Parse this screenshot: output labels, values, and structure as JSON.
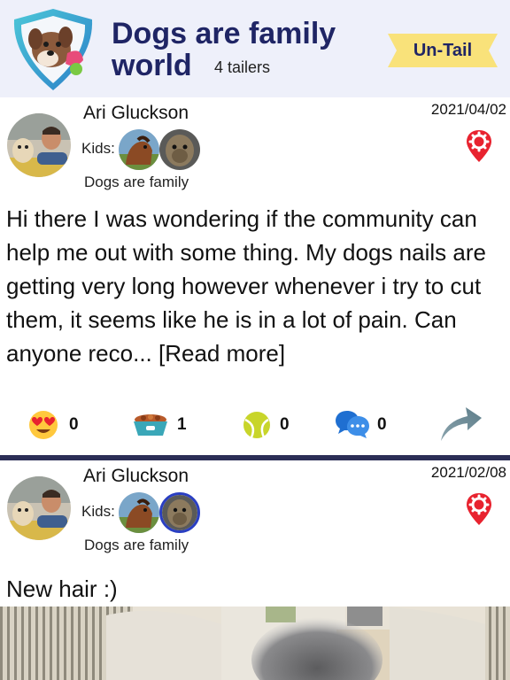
{
  "group": {
    "title_line1": "Dogs are family",
    "title_line2": "world",
    "tailers": "4 tailers",
    "untail_label": "Un-Tail",
    "logo_icon": "dog-shield-logo-icon"
  },
  "posts": [
    {
      "author": "Ari Gluckson",
      "date": "2021/04/02",
      "kids_label": "Kids:",
      "group_name": "Dogs are family",
      "body": "Hi there I was wondering if the community can help me out with some thing. My dogs nails are getting very long however whenever i try to cut them, it seems like he is in a lot of pain. Can anyone reco...",
      "read_more": " [Read more]",
      "reactions": {
        "love": "0",
        "food": "1",
        "ball": "0",
        "comments": "0"
      }
    },
    {
      "author": "Ari Gluckson",
      "date": "2021/02/08",
      "kids_label": "Kids:",
      "group_name": "Dogs are family",
      "body": "New hair :)"
    }
  ],
  "colors": {
    "header_bg": "#eef0fa",
    "title": "#1f2565",
    "untail_yellow": "#f9e27a",
    "divider": "#2b2e56",
    "settings_red": "#e8232f"
  }
}
